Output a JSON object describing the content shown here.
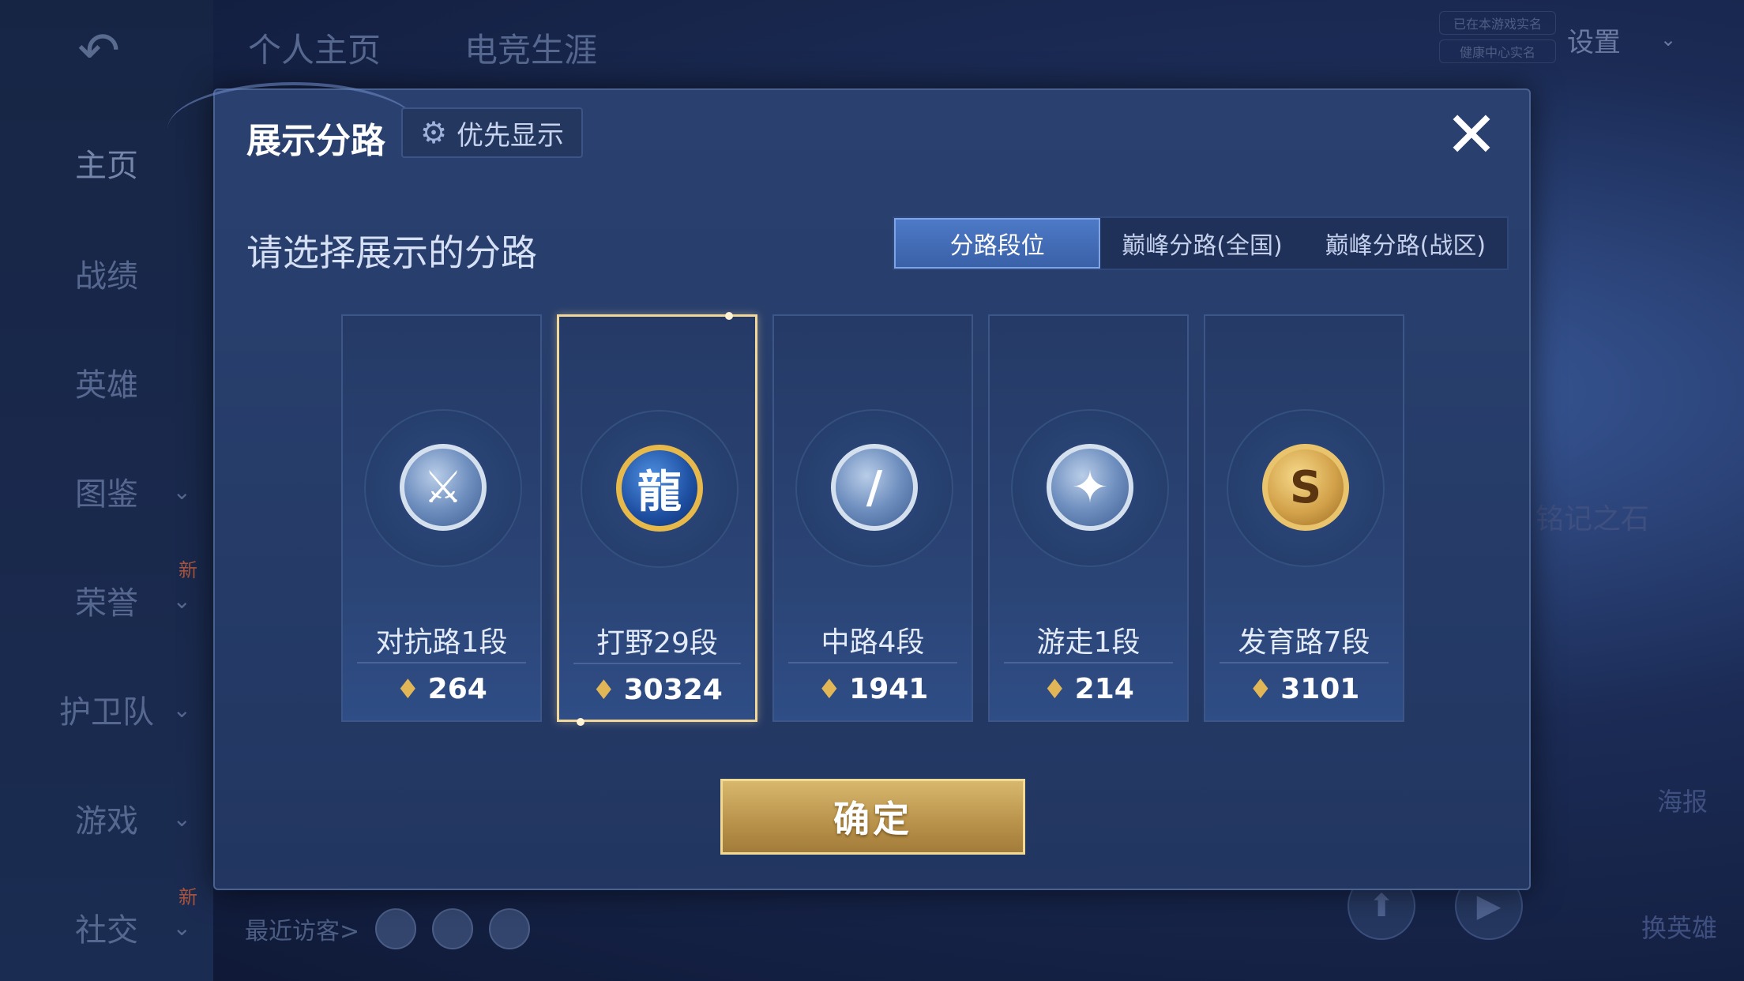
{
  "top_tabs": [
    "个人主页",
    "电竞生涯"
  ],
  "settings_label": "设置",
  "ingame_tags": [
    "已在本游戏实名",
    "健康中心实名"
  ],
  "sidebar": {
    "items": [
      {
        "label": "主页",
        "chevron": false,
        "new": false
      },
      {
        "label": "战绩",
        "chevron": false,
        "new": false
      },
      {
        "label": "英雄",
        "chevron": false,
        "new": false
      },
      {
        "label": "图鉴",
        "chevron": true,
        "new": false
      },
      {
        "label": "荣誉",
        "chevron": true,
        "new": true
      },
      {
        "label": "护卫队",
        "chevron": true,
        "new": false
      },
      {
        "label": "游戏",
        "chevron": true,
        "new": false
      },
      {
        "label": "社交",
        "chevron": true,
        "new": true
      }
    ],
    "new_badge": "新"
  },
  "recent_visitors_label": "最近访客>",
  "right_deco": {
    "stone_label": "铭记之石",
    "poster_label": "海报",
    "change_hero_label": "换英雄"
  },
  "modal": {
    "title": "展示分路",
    "priority_label": "优先显示",
    "close_icon": "close-icon",
    "prompt": "请选择展示的分路",
    "tabs": [
      {
        "label": "分路段位",
        "active": true
      },
      {
        "label": "巅峰分路(全国)",
        "active": false
      },
      {
        "label": "巅峰分路(战区)",
        "active": false
      }
    ],
    "cards": [
      {
        "name": "对抗路1段",
        "score": "264",
        "emblem": "crossed-swords-icon",
        "style": "silver",
        "selected": false
      },
      {
        "name": "打野29段",
        "score": "30324",
        "emblem": "dragon-icon",
        "style": "gold",
        "selected": true
      },
      {
        "name": "中路4段",
        "score": "1941",
        "emblem": "slash-icon",
        "style": "silver",
        "selected": false
      },
      {
        "name": "游走1段",
        "score": "214",
        "emblem": "wings-icon",
        "style": "silver",
        "selected": false
      },
      {
        "name": "发育路7段",
        "score": "3101",
        "emblem": "s-coin-icon",
        "style": "bronze",
        "selected": false
      }
    ],
    "confirm_label": "确定"
  }
}
